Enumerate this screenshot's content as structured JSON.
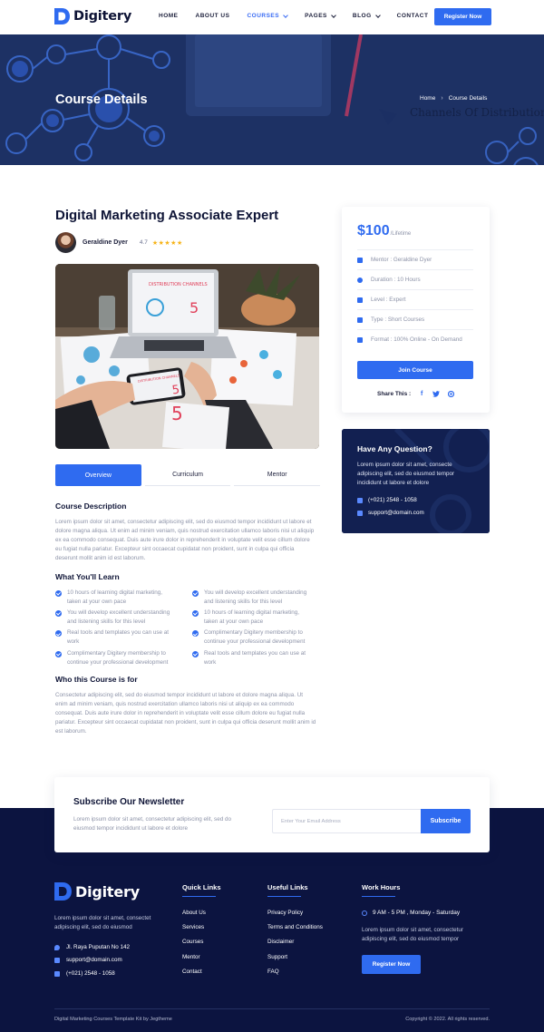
{
  "brand": {
    "name": "Digitery"
  },
  "nav": {
    "items": [
      {
        "label": "HOME",
        "dropdown": false,
        "active": false
      },
      {
        "label": "ABOUT US",
        "dropdown": false,
        "active": false
      },
      {
        "label": "COURSES",
        "dropdown": true,
        "active": true
      },
      {
        "label": "PAGES",
        "dropdown": true,
        "active": false
      },
      {
        "label": "BLOG",
        "dropdown": true,
        "active": false
      },
      {
        "label": "CONTACT",
        "dropdown": false,
        "active": false
      }
    ],
    "cta": "Register Now"
  },
  "hero": {
    "title": "Course Details",
    "breadcrumb": [
      "Home",
      "Course Details"
    ],
    "background_text": "Channels Of Distribution"
  },
  "course": {
    "title": "Digital Marketing Associate Expert",
    "author": "Geraldine Dyer",
    "rating": "4.7",
    "stars": "★★★★★",
    "tabs": [
      "Overview",
      "Curriculum",
      "Mentor"
    ],
    "active_tab": "Overview",
    "image_texts": {
      "screen_title": "DISTRIBUTION CHANNELS",
      "big_number": "5",
      "phone_title": "DISTRIBUTION CHANNELS"
    },
    "description_heading": "Course Description",
    "description": "Lorem ipsum dolor sit amet, consectetur adipiscing elit, sed do eiusmod tempor incididunt ut labore et dolore magna aliqua. Ut enim ad minim veniam, quis nostrud exercitation ullamco laboris nisi ut aliquip ex ea commodo consequat. Duis aute irure dolor in reprehenderit in voluptate velit esse cillum dolore eu fugiat nulla pariatur. Excepteur sint occaecat cupidatat non proident, sunt in culpa qui officia deserunt mollit anim id est laborum.",
    "learn_heading": "What You'll Learn",
    "learn_left": [
      "10 hours of learning digital marketing, taken at your own pace",
      "You will develop excellent understanding and listening skills for this level",
      "Real tools and templates you can use at work",
      "Complimentary Digitery membership to continue your professional development"
    ],
    "learn_right": [
      "You will develop excellent understanding and listening skills for this level",
      "10 hours of learning digital marketing, taken at your own pace",
      "Complimentary Digitery membership to continue your professional development",
      "Real tools and templates you can use at work"
    ],
    "who_heading": "Who this Course is for",
    "who_text": "Consectetur adipiscing elit, sed do eiusmod tempor incididunt ut labore et dolore magna aliqua. Ut enim ad minim veniam, quis nostrud exercitation ullamco laboris nisi ut aliquip ex ea commodo consequat. Duis aute irure dolor in reprehenderit in voluptate velit esse cillum dolore eu fugiat nulla pariatur. Excepteur sint occaecat cupidatat non proident, sunt in culpa qui officia deserunt mollit anim id est laborum."
  },
  "sidebar": {
    "price": "$100",
    "price_unit": "/Lifetime",
    "meta": [
      {
        "icon": "user-icon",
        "text": "Mentor : Geraldine Dyer"
      },
      {
        "icon": "clock-icon",
        "text": "Duration : 10 Hours"
      },
      {
        "icon": "level-icon",
        "text": "Level : Expert"
      },
      {
        "icon": "book-icon",
        "text": "Type : Short Courses"
      },
      {
        "icon": "monitor-icon",
        "text": "Format : 100% Online - On Demand"
      }
    ],
    "join_label": "Join Course",
    "share_label": "Share This :",
    "question": {
      "title": "Have Any Question?",
      "text": "Lorem ipsum dolor sit amet, consecte adipiscing elit, sed do eiusmod tempor incididunt ut labore et dolore",
      "phone": "(+021) 2548 - 1058",
      "email": "support@domain.com"
    }
  },
  "newsletter": {
    "title": "Subscribe Our Newsletter",
    "text": "Lorem ipsum dolor sit amet, consectetur adipiscing elit, sed do eiusmod tempor incididunt ut labore et dolore",
    "placeholder": "Enter Your Email Address",
    "button": "Subscribe"
  },
  "footer": {
    "about": "Lorem ipsum dolor sit amet, consectet adipiscing elit, sed do eiusmod",
    "address": "Jl. Raya Puputan No 142",
    "email": "support@domain.com",
    "phone": "(+021) 2548 - 1058",
    "quick_links_title": "Quick Links",
    "quick_links": [
      "About Us",
      "Services",
      "Courses",
      "Mentor",
      "Contact"
    ],
    "useful_links_title": "Useful Links",
    "useful_links": [
      "Privacy Policy",
      "Terms and Conditions",
      "Disclaimer",
      "Support",
      "FAQ"
    ],
    "work_hours_title": "Work Hours",
    "work_hours": "9 AM - 5 PM , Monday - Saturday",
    "work_text": "Lorem ipsum dolor sit amet, consectetur adipiscing elit, sed do eiusmod tempor",
    "register": "Register Now",
    "credit": "Digital Marketing Courses Template Kit by Jegtheme",
    "copyright": "Copyright © 2022. All rights reserved."
  },
  "colors": {
    "accent": "#2f6bf0",
    "navy": "#0c1440",
    "hero": "#1e3161",
    "star": "#f6b316"
  }
}
